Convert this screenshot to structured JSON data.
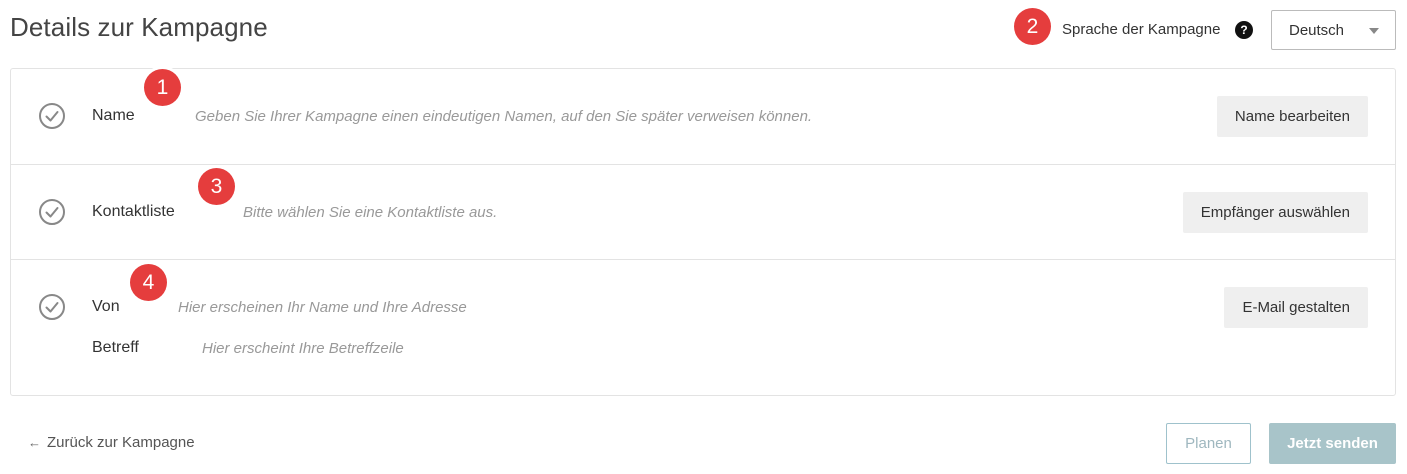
{
  "header": {
    "title": "Details zur Kampagne",
    "language_label": "Sprache der Kampagne",
    "help_icon_glyph": "?",
    "language_selected": "Deutsch"
  },
  "badges": [
    "1",
    "2",
    "3",
    "4"
  ],
  "rows": [
    {
      "label": "Name",
      "hint": "Geben Sie Ihrer Kampagne einen eindeutigen Namen, auf den Sie später verweisen können.",
      "button": "Name bearbeiten"
    },
    {
      "label": "Kontaktliste",
      "hint": "Bitte wählen Sie eine Kontaktliste aus.",
      "button": "Empfänger auswählen"
    },
    {
      "label": "Von",
      "hint": "Hier erscheinen Ihr Name und Ihre Adresse",
      "label2": "Betreff",
      "hint2": "Hier erscheint Ihre Betreffzeile",
      "button": "E-Mail gestalten"
    }
  ],
  "footer": {
    "back_arrow": "←",
    "back_label": "Zurück zur Kampagne",
    "plan_label": "Planen",
    "send_label": "Jetzt senden"
  },
  "colors": {
    "badge": "#e53d3d",
    "send_button": "#a8c4c9",
    "plan_border": "#9fc2cc",
    "check_icon": "#888888"
  }
}
